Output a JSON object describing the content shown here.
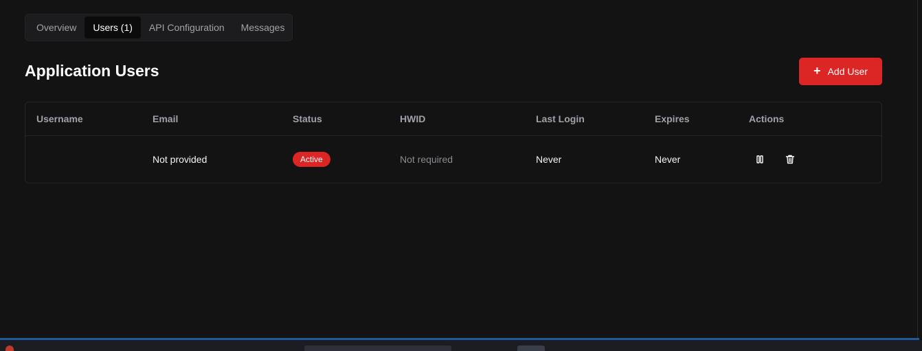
{
  "tabs": [
    {
      "label": "Overview",
      "active": false
    },
    {
      "label": "Users (1)",
      "active": true
    },
    {
      "label": "API Configuration",
      "active": false
    },
    {
      "label": "Messages",
      "active": false
    }
  ],
  "page": {
    "title": "Application Users",
    "add_button_label": "Add User"
  },
  "table": {
    "headers": [
      "Username",
      "Email",
      "Status",
      "HWID",
      "Last Login",
      "Expires",
      "Actions"
    ],
    "rows": [
      {
        "username": "",
        "email": "Not provided",
        "status": "Active",
        "hwid": "Not required",
        "last_login": "Never",
        "expires": "Never",
        "actions": [
          "pause-icon",
          "trash-icon"
        ]
      }
    ]
  },
  "colors": {
    "background": "#131314",
    "accent": "#dc2626",
    "muted_text": "#a1a1aa"
  }
}
